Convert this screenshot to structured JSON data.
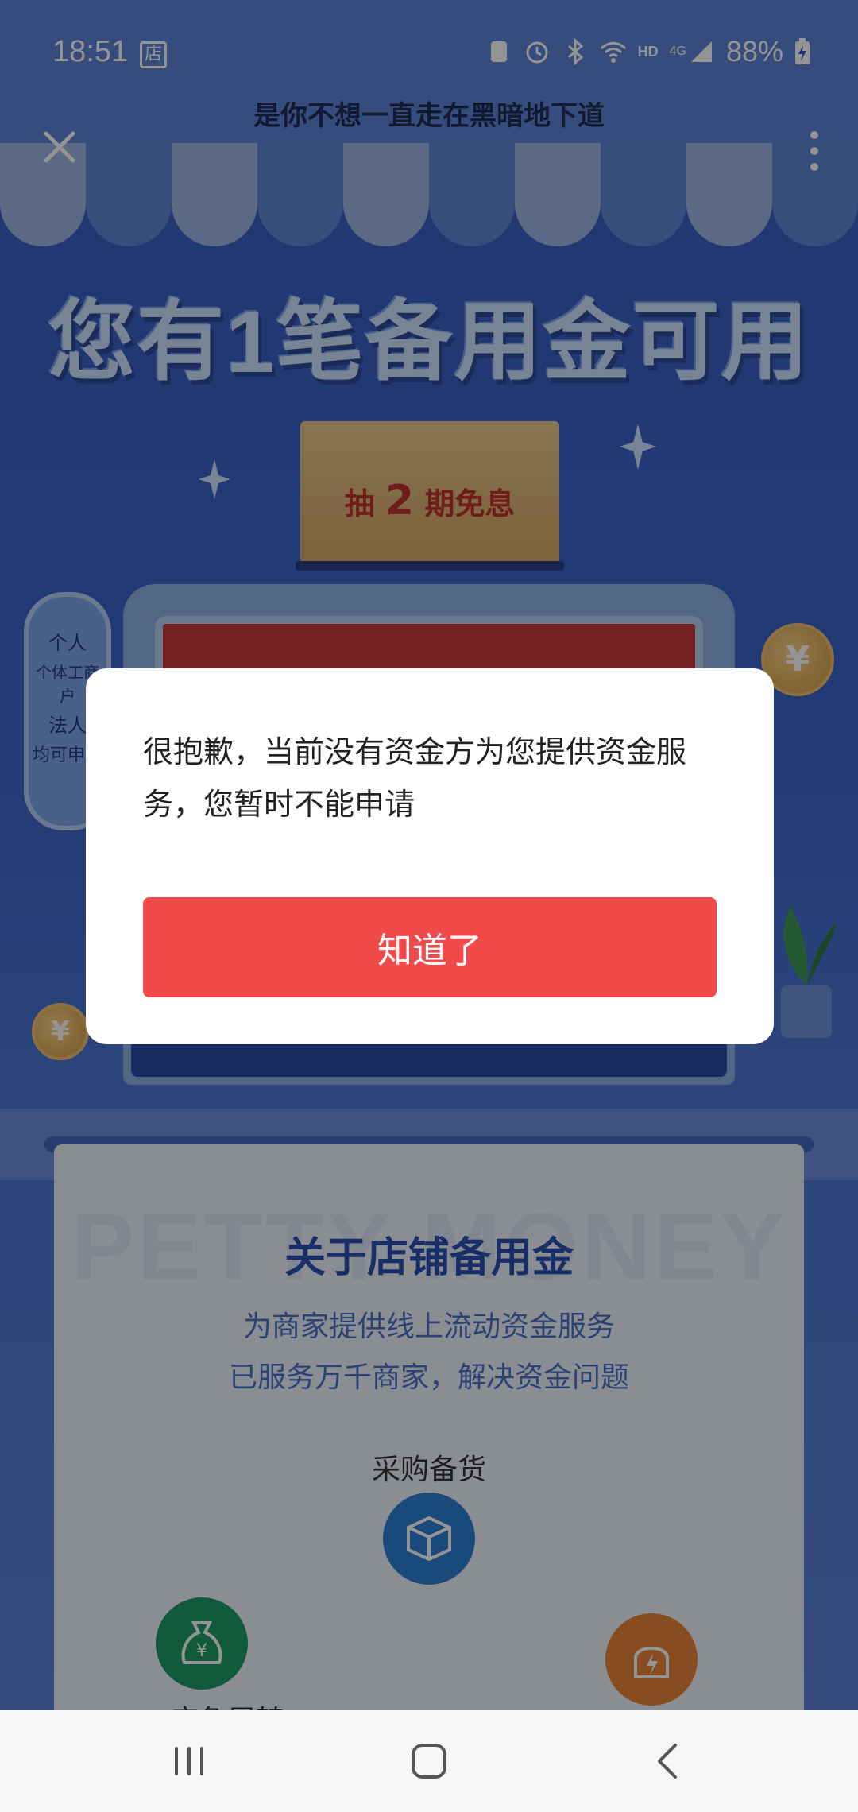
{
  "status_bar": {
    "time": "18:51",
    "store_badge": "店",
    "network_hd": "HD",
    "network_type": "4G",
    "battery": "88%",
    "icons": [
      "recycle-icon",
      "alarm-icon",
      "bluetooth-icon",
      "wifi-icon",
      "signal-icon",
      "battery-charging-icon"
    ]
  },
  "header": {
    "title": "是你不想一直走在黑暗地下道",
    "close_icon": "close-icon",
    "more_icon": "more-vertical-icon"
  },
  "banner": {
    "headline": "您有1笔备用金可用",
    "ticket_prefix": "抽",
    "ticket_number": "2",
    "ticket_suffix": "期免息",
    "side_tags": [
      "个人",
      "个体工商户",
      "法人",
      "均可申请"
    ]
  },
  "info": {
    "watermark": "PETTY MONEY",
    "title": "关于店铺备用金",
    "line1": "为商家提供线上流动资金服务",
    "line2": "已服务万千商家，解决资金问题",
    "feature_top": "采购备货",
    "feature_left": "应急周转"
  },
  "dialog": {
    "message": "很抱歉，当前没有资金方为您提供资金服务，您暂时不能申请",
    "button_label": "知道了"
  },
  "nav": {
    "icons": [
      "recents-icon",
      "home-icon",
      "back-icon"
    ]
  },
  "colors": {
    "primary_button": "#f04b4a",
    "background_blue": "#3b5fc4",
    "ticket_red": "#c0332e"
  }
}
